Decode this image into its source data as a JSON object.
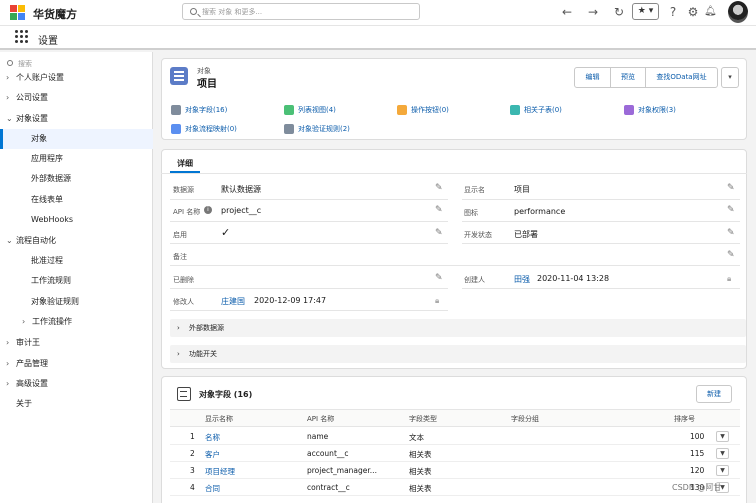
{
  "header": {
    "brand": "华货魔方",
    "search_placeholder": "搜索 对象 和更多...",
    "star_label": "★ ▾",
    "brand_colors": [
      "#e94235",
      "#fbbc05",
      "#34a853",
      "#4285f4"
    ]
  },
  "appbar": {
    "title": "设置"
  },
  "sidebar": {
    "search_placeholder": "搜索",
    "items": [
      {
        "label": "个人账户设置",
        "caret": "›"
      },
      {
        "label": "公司设置",
        "caret": "›"
      },
      {
        "label": "对象设置",
        "caret": "⌄"
      },
      {
        "label": "对象"
      },
      {
        "label": "应用程序"
      },
      {
        "label": "外部数据源"
      },
      {
        "label": "在线表单"
      },
      {
        "label": "WebHooks"
      },
      {
        "label": "流程自动化",
        "caret": "⌄"
      },
      {
        "label": "批准过程"
      },
      {
        "label": "工作流规则"
      },
      {
        "label": "对象验证规则"
      },
      {
        "label": "工作流操作",
        "caret": "›"
      },
      {
        "label": "审计王",
        "caret": "›"
      },
      {
        "label": "产品管理",
        "caret": "›"
      },
      {
        "label": "高级设置",
        "caret": "›"
      },
      {
        "label": "关于"
      }
    ]
  },
  "object": {
    "type_label": "对象",
    "name": "项目",
    "buttons": [
      "编辑",
      "预览",
      "查找OData网址",
      "▾"
    ],
    "links": [
      {
        "label": "对象字段(16)",
        "color": "#7f8c9c"
      },
      {
        "label": "列表视图(4)",
        "color": "#4bc076"
      },
      {
        "label": "操作按钮(0)",
        "color": "#f4a93b"
      },
      {
        "label": "相关子表(0)",
        "color": "#3bb7b0"
      },
      {
        "label": "对象权限(3)",
        "color": "#9b6ad8"
      },
      {
        "label": "对象流程映射(0)",
        "color": "#5b8ff0"
      },
      {
        "label": "对象验证规则(2)",
        "color": "#7f8c9c"
      }
    ]
  },
  "detail": {
    "tab": "详细",
    "fields_left": [
      {
        "label": "数据源",
        "value": "默认数据源"
      },
      {
        "label": "API 名称",
        "value": "project__c"
      },
      {
        "label": "启用",
        "value": "✓"
      },
      {
        "label": "备注",
        "value": ""
      },
      {
        "label": "已删除",
        "value": ""
      },
      {
        "label": "修改人",
        "value": "庄建国",
        "date": "2020-12-09 17:47"
      }
    ],
    "fields_right": [
      {
        "label": "显示名",
        "value": "项目"
      },
      {
        "label": "图标",
        "value": "performance"
      },
      {
        "label": "开发状态",
        "value": "已部署"
      },
      {
        "label": "创建人",
        "value": "田强",
        "date": "2020-11-04 13:28"
      }
    ],
    "sections": [
      "外部数据源",
      "功能开关"
    ]
  },
  "related": {
    "title": "对象字段 (16)",
    "new_button": "新建",
    "columns": [
      "显示名称",
      "API 名称",
      "字段类型",
      "字段分组",
      "排序号"
    ],
    "rows": [
      {
        "n": "1",
        "name": "名称",
        "api": "name",
        "type": "文本",
        "group": "",
        "sort": "100"
      },
      {
        "n": "2",
        "name": "客户",
        "api": "account__c",
        "type": "相关表",
        "group": "",
        "sort": "115"
      },
      {
        "n": "3",
        "name": "项目经理",
        "api": "project_manager...",
        "type": "相关表",
        "group": "",
        "sort": "120"
      },
      {
        "n": "4",
        "name": "合同",
        "api": "contract__c",
        "type": "相关表",
        "group": "",
        "sort": "130"
      }
    ]
  },
  "watermark": "CSDN @阿甘"
}
